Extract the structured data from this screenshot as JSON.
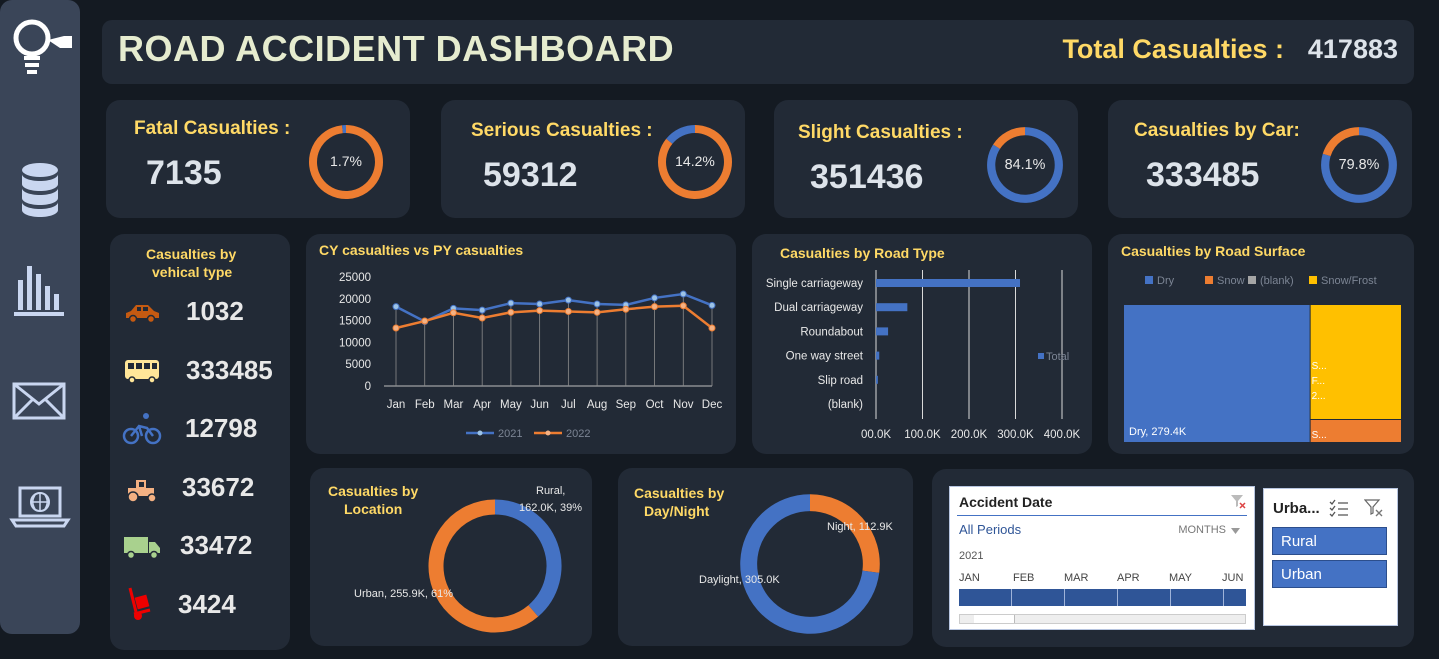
{
  "header": {
    "title": "ROAD ACCIDENT DASHBOARD",
    "total_label": "Total Casualties :",
    "total_value": "417883"
  },
  "sidebar": {
    "icons": [
      "lightbulb-icon",
      "database-icon",
      "bar-chart-icon",
      "mail-icon",
      "laptop-globe-icon"
    ]
  },
  "kpis": [
    {
      "label": "Fatal Casualties :",
      "value": "7135",
      "pct": "1.7%",
      "fraction": 0.017
    },
    {
      "label": "Serious Casualties :",
      "value": "59312",
      "pct": "14.2%",
      "fraction": 0.142
    },
    {
      "label": "Slight Casualties :",
      "value": "351436",
      "pct": "84.1%",
      "fraction": 0.841
    },
    {
      "label": "Casualties by Car:",
      "value": "333485",
      "pct": "79.8%",
      "fraction": 0.798
    }
  ],
  "vehicle": {
    "title_line1": "Casualties  by",
    "title_line2": "vehical type",
    "rows": [
      {
        "icon": "car-icon",
        "value": "1032"
      },
      {
        "icon": "bus-icon",
        "value": "333485"
      },
      {
        "icon": "bicycle-icon",
        "value": "12798"
      },
      {
        "icon": "tractor-icon",
        "value": "33672"
      },
      {
        "icon": "truck-icon",
        "value": "33472"
      },
      {
        "icon": "hand-truck-icon",
        "value": "3424"
      }
    ]
  },
  "line_chart": {
    "title": "CY casualties vs PY casualties",
    "legend": [
      "2021",
      "2022"
    ],
    "y_ticks": [
      "25000",
      "20000",
      "15000",
      "10000",
      "5000",
      "0"
    ]
  },
  "road_type": {
    "title": "Casualties by Road Type",
    "legend": "Total",
    "x_ticks": [
      "00.0K",
      "100.0K",
      "200.0K",
      "300.0K",
      "400.0K"
    ]
  },
  "road_surface": {
    "title": "Casualties by Road Surface",
    "legend": [
      "Dry",
      "Snow",
      "(blank)",
      "Snow/Frost"
    ],
    "dry_label": "Dry, 279.4K",
    "frost_label_lines": [
      "S...",
      "F...",
      "2..."
    ],
    "snow_label": "S..."
  },
  "location": {
    "title_line1": "Casualties  by",
    "title_line2": "Location",
    "rural_line1": "Rural,",
    "rural_line2": "162.0K, 39%",
    "urban_label": "Urban, 255.9K, 61%"
  },
  "daynight": {
    "title_line1": "Casualties  by",
    "title_line2": "Day/Night",
    "night_label": "Night, 112.9K",
    "day_label": "Daylight, 305.0K"
  },
  "timeline": {
    "title": "Accident Date",
    "periods": "All Periods",
    "level": "MONTHS",
    "year": "2021",
    "months": [
      "JAN",
      "FEB",
      "MAR",
      "APR",
      "MAY",
      "JUN"
    ]
  },
  "urban_slicer": {
    "title": "Urba...",
    "options": [
      "Rural",
      "Urban"
    ]
  },
  "colors": {
    "blue": "#4472c4",
    "orange": "#ed7d31",
    "yellow": "#ffd966",
    "gray": "#a5a5a5",
    "gold": "#ffc000"
  },
  "chart_data": [
    {
      "type": "line",
      "title": "CY casualties vs PY casualties",
      "categories": [
        "Jan",
        "Feb",
        "Mar",
        "Apr",
        "May",
        "Jun",
        "Jul",
        "Aug",
        "Sep",
        "Oct",
        "Nov",
        "Dec"
      ],
      "series": [
        {
          "name": "2021",
          "values": [
            18200,
            14800,
            17800,
            17400,
            19000,
            18800,
            19700,
            18800,
            18600,
            20200,
            21100,
            18500
          ]
        },
        {
          "name": "2022",
          "values": [
            13300,
            14900,
            16800,
            15600,
            16900,
            17300,
            17100,
            16900,
            17600,
            18200,
            18400,
            13300
          ]
        }
      ],
      "ylim": [
        0,
        25000
      ]
    },
    {
      "type": "bar",
      "title": "Casualties by Road Type",
      "orientation": "horizontal",
      "categories": [
        "Single carriageway",
        "Dual carriageway",
        "Roundabout",
        "One way street",
        "Slip road",
        "(blank)"
      ],
      "series": [
        {
          "name": "Total",
          "values": [
            309700,
            67400,
            26000,
            7000,
            4000,
            0
          ]
        }
      ],
      "xlim": [
        0,
        400000
      ]
    },
    {
      "type": "treemap",
      "title": "Casualties by Road Surface",
      "categories": [
        "Dry",
        "Snow/Frost",
        "Snow",
        "(blank)"
      ],
      "values": [
        279400,
        115000,
        22000,
        500
      ]
    },
    {
      "type": "pie",
      "title": "Casualties by Location",
      "categories": [
        "Rural",
        "Urban"
      ],
      "values": [
        162000,
        255900
      ]
    },
    {
      "type": "pie",
      "title": "Casualties by Day/Night",
      "categories": [
        "Night",
        "Daylight"
      ],
      "values": [
        112900,
        305000
      ]
    }
  ]
}
